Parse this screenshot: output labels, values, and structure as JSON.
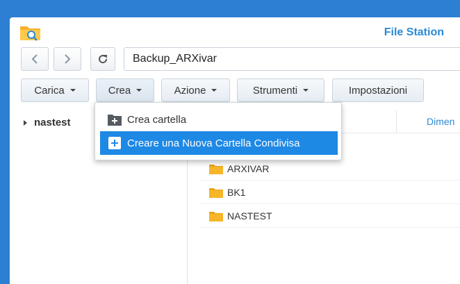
{
  "app": {
    "title": "File Station"
  },
  "navigation": {
    "back_icon": "chevron-left-icon",
    "forward_icon": "chevron-right-icon",
    "refresh_icon": "refresh-icon",
    "path": "Backup_ARXivar"
  },
  "toolbar": {
    "upload": "Carica",
    "create": "Crea",
    "action": "Azione",
    "tools": "Strumenti",
    "settings": "Impostazioni"
  },
  "sidebar": {
    "items": [
      {
        "label": "nastest"
      }
    ]
  },
  "list": {
    "columns": {
      "size": "Dimen"
    },
    "rows": [
      {
        "name": "ARXIVAR"
      },
      {
        "name": "BK1"
      },
      {
        "name": "NASTEST"
      }
    ]
  },
  "create_menu": {
    "items": [
      {
        "label": "Crea cartella",
        "icon": "folder-plus-icon"
      },
      {
        "label": "Creare una Nuova Cartella Condivisa",
        "icon": "plus-icon"
      }
    ]
  },
  "colors": {
    "accent": "#2a8ad6",
    "selection": "#1e88e5",
    "folder": "#f7b529",
    "desktop": "#2d7fd3"
  }
}
